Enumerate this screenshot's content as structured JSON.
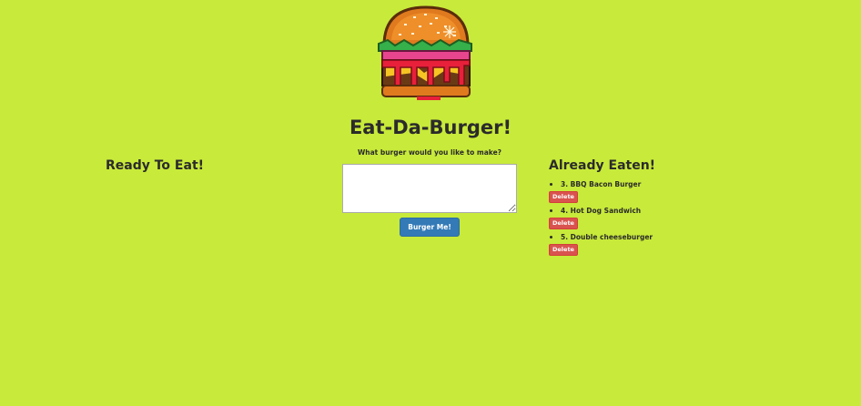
{
  "header": {
    "title": "Eat-Da-Burger!",
    "logo": "pixel-burger-logo"
  },
  "ready": {
    "heading": "Ready To Eat!"
  },
  "form": {
    "prompt": "What burger would you like to make?",
    "value": "",
    "submit_label": "Burger Me!"
  },
  "eaten": {
    "heading": "Already Eaten!",
    "items": [
      {
        "label": "3. BBQ Bacon Burger",
        "delete_label": "Delete"
      },
      {
        "label": "4. Hot Dog Sandwich",
        "delete_label": "Delete"
      },
      {
        "label": "5. Double cheeseburger",
        "delete_label": "Delete"
      }
    ]
  },
  "colors": {
    "background": "#c8ea3a",
    "primary": "#337ab7",
    "danger": "#d9534f",
    "text": "#2b2b2b"
  }
}
